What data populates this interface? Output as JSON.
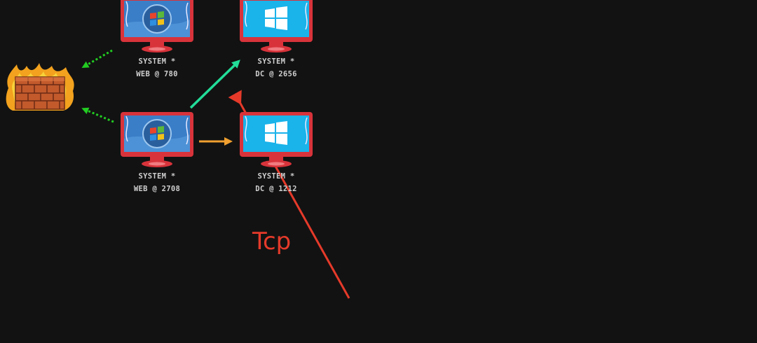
{
  "nodes": [
    {
      "id": "web-780",
      "os": "windows-7",
      "line1": "SYSTEM *",
      "line2": "WEB @ 780"
    },
    {
      "id": "dc-2656",
      "os": "windows-10",
      "line1": "SYSTEM *",
      "line2": "DC @ 2656"
    },
    {
      "id": "web-2708",
      "os": "windows-7",
      "line1": "SYSTEM *",
      "line2": "WEB @ 2708"
    },
    {
      "id": "dc-1212",
      "os": "windows-10",
      "line1": "SYSTEM *",
      "line2": "DC @ 1212"
    }
  ],
  "firewall": {
    "icon": "firewall-icon"
  },
  "annotation": {
    "text": "Tcp",
    "color": "#e53a2a"
  },
  "edges": [
    {
      "from": "web-780",
      "to": "firewall",
      "style": "dotted",
      "color": "#22cc22"
    },
    {
      "from": "web-2708",
      "to": "firewall",
      "style": "dotted",
      "color": "#22cc22"
    },
    {
      "from": "web-2708",
      "to": "dc-2656",
      "style": "solid",
      "color": "#22dd99"
    },
    {
      "from": "web-2708",
      "to": "dc-1212",
      "style": "solid",
      "color": "#f0a030"
    }
  ],
  "colors": {
    "background": "#121212",
    "monitor_frame": "#d8333b",
    "win7_screen": "#3a7ec8",
    "win10_screen": "#1ab3ea",
    "annotation_arrow": "#e53a2a"
  }
}
